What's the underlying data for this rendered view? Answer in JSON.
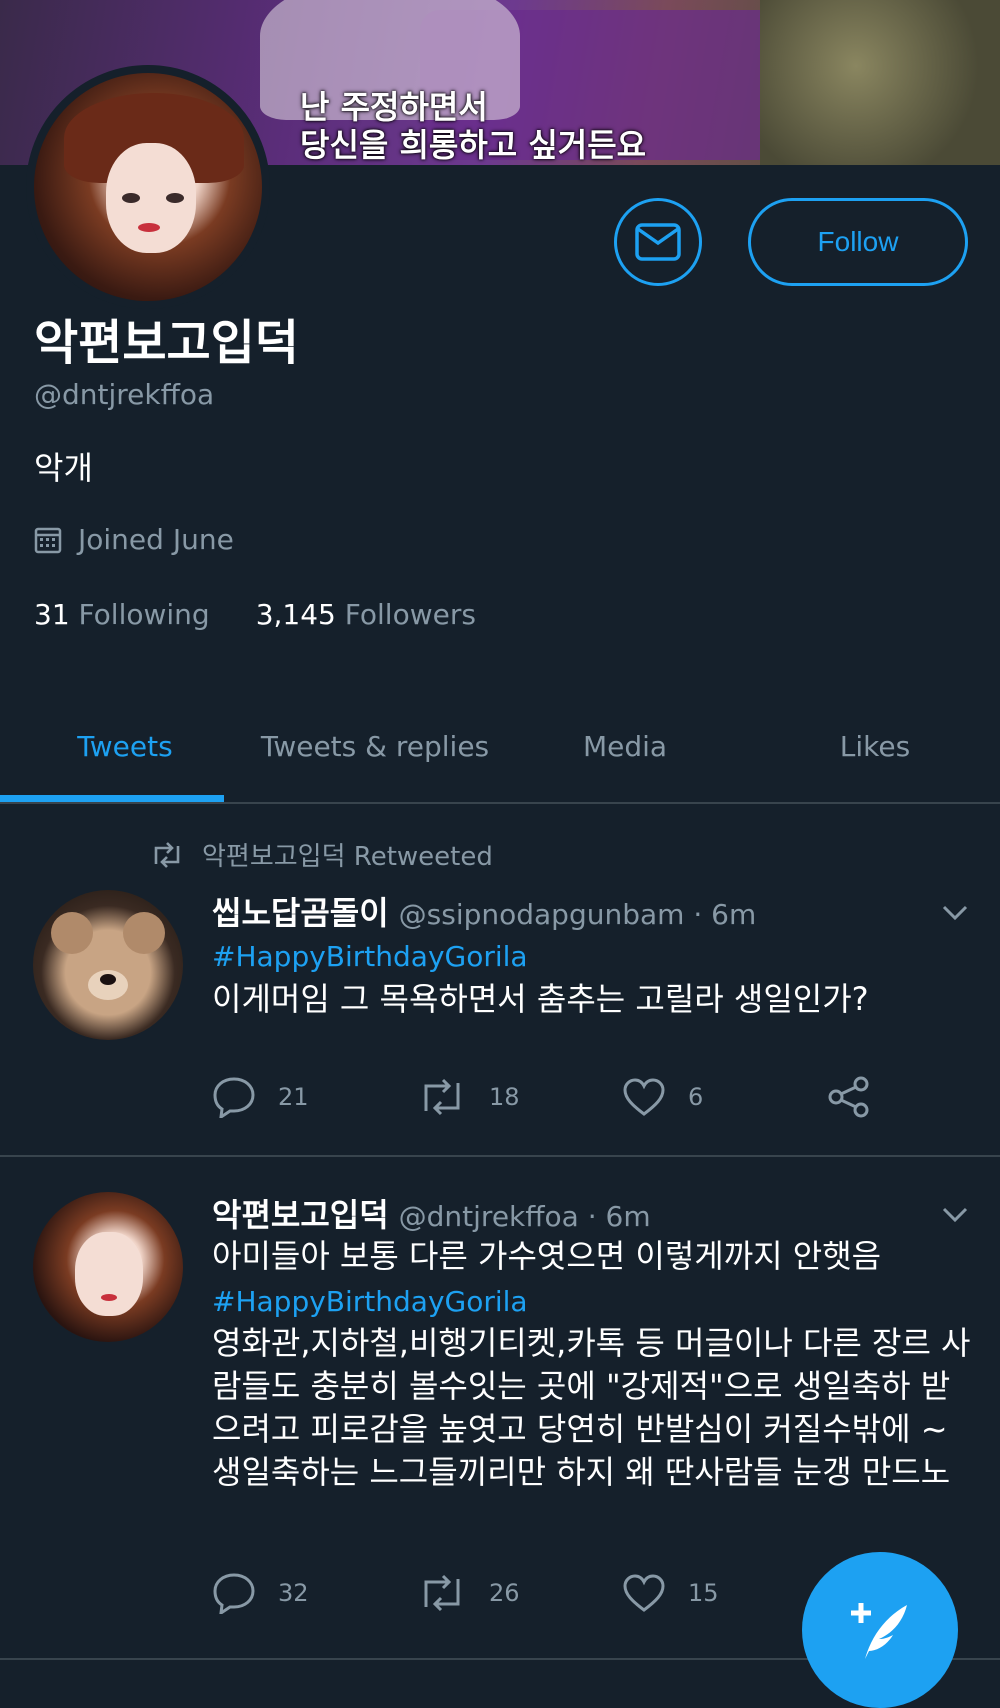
{
  "banner": {
    "caption": "난 주정하면서\n당신을 희롱하고 싶거든요"
  },
  "profile": {
    "name": "악편보고입덕",
    "handle": "@dntjrekffoa",
    "bio": "악개",
    "joined": "Joined June",
    "following_count": "31",
    "following_label": "Following",
    "followers_count": "3,145",
    "followers_label": "Followers",
    "follow_label": "Follow"
  },
  "tabs": [
    {
      "label": "Tweets",
      "active": true
    },
    {
      "label": "Tweets & replies",
      "active": false
    },
    {
      "label": "Media",
      "active": false
    },
    {
      "label": "Likes",
      "active": false
    }
  ],
  "tweets": [
    {
      "retweeted_by": "악편보고입덕",
      "retweeted_label": "Retweeted",
      "name": "씹노답곰돌이",
      "handle": "@ssipnodapgunbam",
      "time": "· 6m",
      "hashtag": "#HappyBirthdayGorila",
      "text": "이게머임 그 목욕하면서 춤추는 고릴라 생일인가?",
      "replies": "21",
      "retweets": "18",
      "likes": "6"
    },
    {
      "name": "악편보고입덕",
      "handle": "@dntjrekffoa",
      "time": "· 6m",
      "text_before": "아미들아 보통 다른 가수엿으면 이렇게까지 안햇음",
      "hashtag": "#HappyBirthdayGorila",
      "text_after": "영화관,지하철,비행기티켓,카톡 등 머글이나 다른 장르 사람들도 충분히 볼수잇는 곳에 \"강제적\"으로 생일축하 받으려고 피로감을 높엿고 당연히 반발심이 커질수밖에 ~ 생일축하는 느그들끼리만 하지 왜 딴사람들 눈갱 만드노",
      "replies": "32",
      "retweets": "26",
      "likes": "15"
    }
  ],
  "colors": {
    "accent": "#1da1f2",
    "background": "#15202b",
    "muted": "#8899a6",
    "divider": "#38444d"
  },
  "icons": [
    "mail-icon",
    "calendar-icon",
    "retweet-icon",
    "chevron-down-icon",
    "reply-icon",
    "like-icon",
    "share-icon",
    "compose-icon"
  ]
}
